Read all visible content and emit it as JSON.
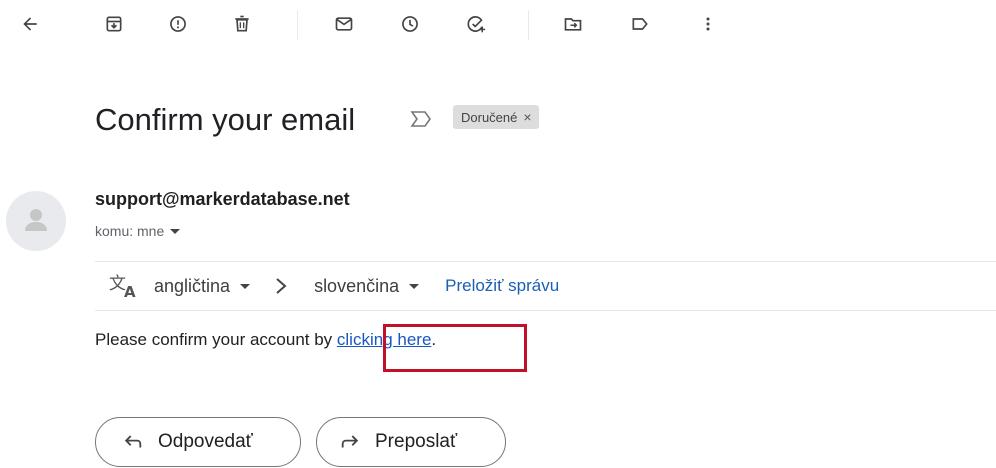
{
  "toolbar": {
    "items": [
      {
        "name": "back-arrow-icon",
        "label": "Back"
      },
      {
        "name": "archive-icon",
        "label": "Archive"
      },
      {
        "name": "report-spam-icon",
        "label": "Report spam"
      },
      {
        "name": "delete-icon",
        "label": "Delete"
      },
      {
        "name": "mark-unread-icon",
        "label": "Mark as unread"
      },
      {
        "name": "snooze-icon",
        "label": "Snooze"
      },
      {
        "name": "add-task-icon",
        "label": "Add to tasks"
      },
      {
        "name": "move-to-icon",
        "label": "Move to"
      },
      {
        "name": "label-icon",
        "label": "Labels"
      },
      {
        "name": "more-vert-icon",
        "label": "More"
      }
    ]
  },
  "email": {
    "subject": "Confirm your email",
    "label_chip": "Doručené",
    "label_chip_close": "×",
    "sender": "support@markerdatabase.net",
    "recipient": "komu: mne",
    "body_prefix": "Please confirm your account by ",
    "link_text": "clicking here",
    "body_suffix": "."
  },
  "translate": {
    "source_lang": "angličtina",
    "target_lang": "slovenčina",
    "action": "Preložiť správu"
  },
  "actions": {
    "reply": "Odpovedať",
    "forward": "Preposlať"
  },
  "colors": {
    "link": "#1a56c2",
    "translate_action": "#1a5fb4",
    "highlight": "#c0102a",
    "chip_bg": "#dddddd"
  }
}
